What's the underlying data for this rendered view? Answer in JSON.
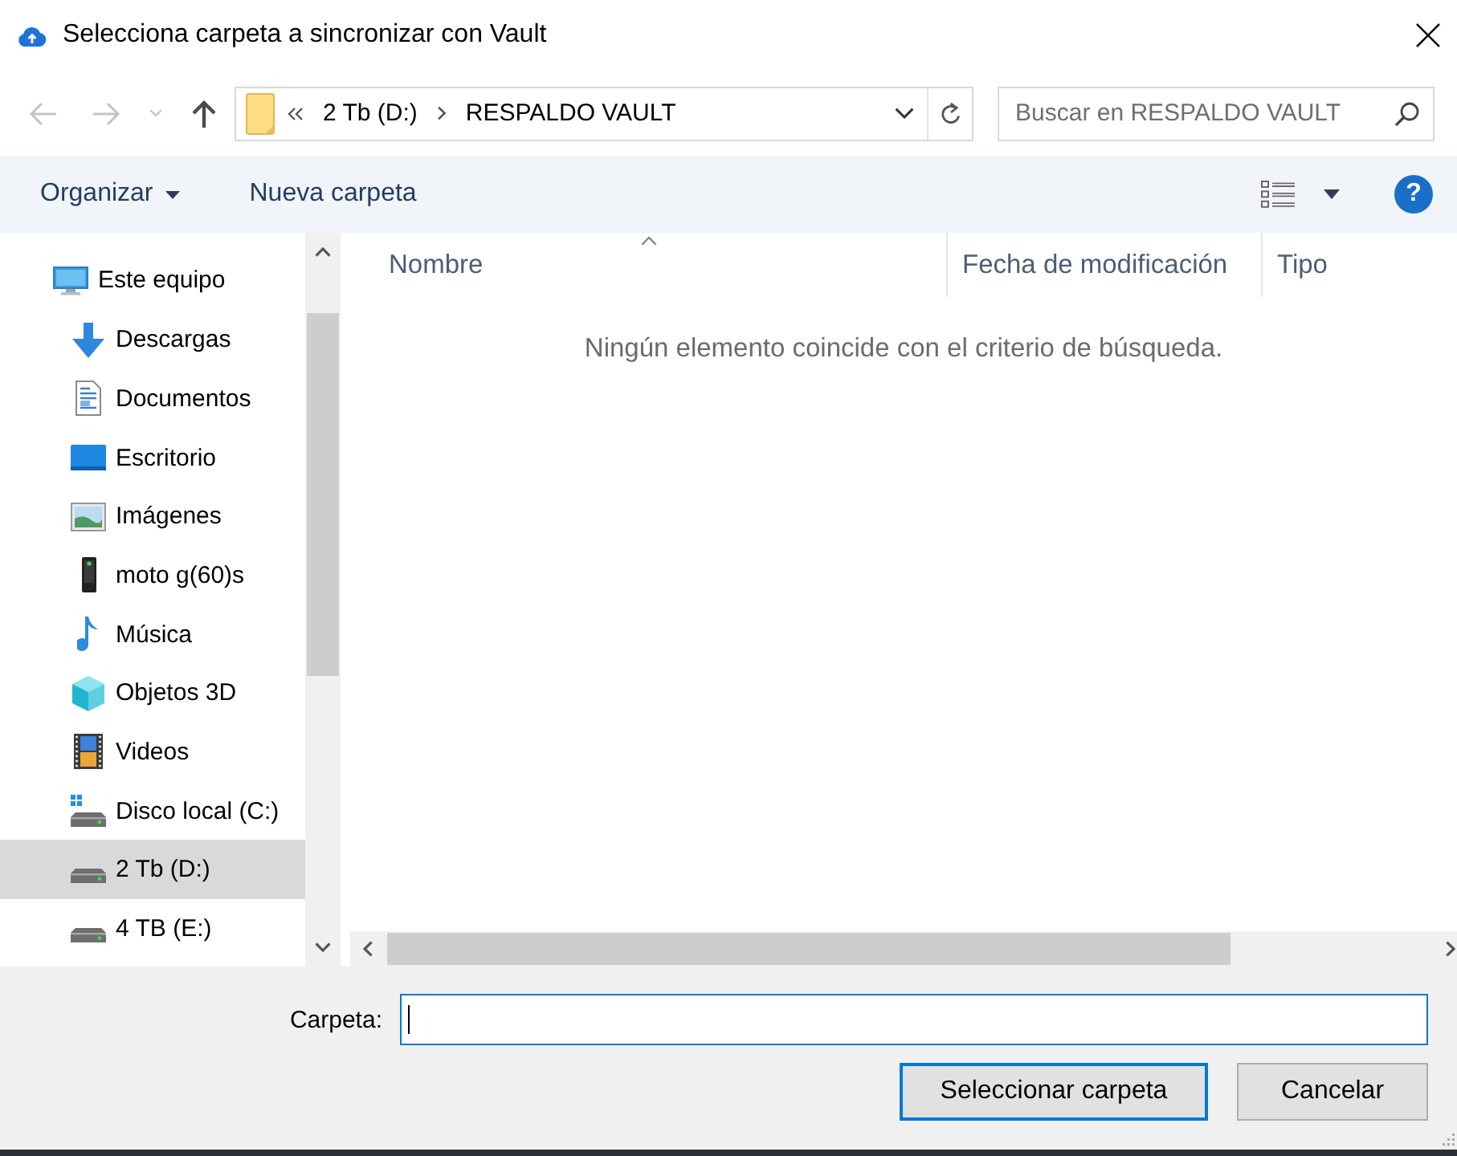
{
  "window": {
    "title": "Selecciona carpeta a sincronizar con Vault"
  },
  "nav_buttons": [
    {
      "kind": "back",
      "disabled": true
    },
    {
      "kind": "forward",
      "disabled": true
    },
    {
      "kind": "recent",
      "disabled": true
    },
    {
      "kind": "up",
      "disabled": false
    }
  ],
  "address_bar": {
    "path": [
      "2 Tb (D:)",
      "RESPALDO VAULT"
    ]
  },
  "search": {
    "placeholder": "Buscar en RESPALDO VAULT"
  },
  "toolbar": {
    "organize": "Organizar",
    "new_folder": "Nueva carpeta",
    "help": "?"
  },
  "nav_pane": {
    "items": [
      {
        "label": "Este equipo",
        "kind": "computer",
        "selected": false,
        "children": [
          {
            "label": "Descargas",
            "kind": "downloads",
            "selected": false
          },
          {
            "label": "Documentos",
            "kind": "documents",
            "selected": false
          },
          {
            "label": "Escritorio",
            "kind": "desktop",
            "selected": false
          },
          {
            "label": "Imágenes",
            "kind": "pictures",
            "selected": false
          },
          {
            "label": "moto g(60)s",
            "kind": "phone",
            "selected": false
          },
          {
            "label": "Música",
            "kind": "music",
            "selected": false
          },
          {
            "label": "Objetos 3D",
            "kind": "objects3d",
            "selected": false
          },
          {
            "label": "Videos",
            "kind": "videos",
            "selected": false
          },
          {
            "label": "Disco local (C:)",
            "kind": "system_drive",
            "selected": false
          },
          {
            "label": "2 Tb (D:)",
            "kind": "drive",
            "selected": true
          },
          {
            "label": "4 TB (E:)",
            "kind": "drive",
            "selected": false
          }
        ]
      }
    ]
  },
  "file_list": {
    "columns": [
      {
        "label": "Nombre",
        "sorted": true
      },
      {
        "label": "Fecha de modificación",
        "sorted": false
      },
      {
        "label": "Tipo",
        "sorted": false
      }
    ],
    "empty_message": "Ningún elemento coincide con el criterio de búsqueda."
  },
  "folder_field": {
    "label": "Carpeta:",
    "focused": true
  },
  "buttons": [
    {
      "label": "Seleccionar carpeta",
      "default": true
    },
    {
      "label": "Cancelar",
      "default": false
    }
  ]
}
